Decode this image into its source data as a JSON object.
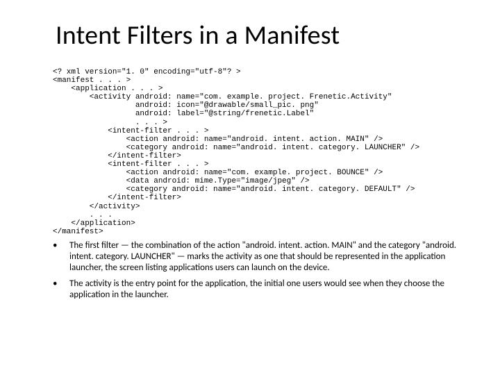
{
  "title": "Intent Filters in a Manifest",
  "code": "<? xml version=\"1. 0\" encoding=\"utf-8\"? >\n<manifest . . . >\n    <application . . . >\n        <activity android: name=\"com. example. project. Frenetic.Activity\"\n                  android: icon=\"@drawable/small_pic. png\"\n                  android: label=\"@string/frenetic.Label\"\n                  . . . >\n            <intent-filter . . . >\n                <action android: name=\"android. intent. action. MAIN\" />\n                <category android: name=\"android. intent. category. LAUNCHER\" />\n            </intent-filter>\n            <intent-filter . . . >\n                <action android: name=\"com. example. project. BOUNCE\" />\n                <data android: mime.Type=\"image/jpeg\" />\n                <category android: name=\"android. intent. category. DEFAULT\" />\n            </intent-filter>\n        </activity>\n        . . .\n    </application>\n</manifest>",
  "bullets": {
    "items": [
      "The first filter — the combination of the action \"android. intent. action. MAIN\" and the category \"android. intent. category. LAUNCHER\" — marks the activity as one that should be represented in the application launcher, the screen listing applications users can launch on the device.",
      "The activity is the entry point for the application, the initial one users would see when they choose the application in the launcher."
    ]
  }
}
